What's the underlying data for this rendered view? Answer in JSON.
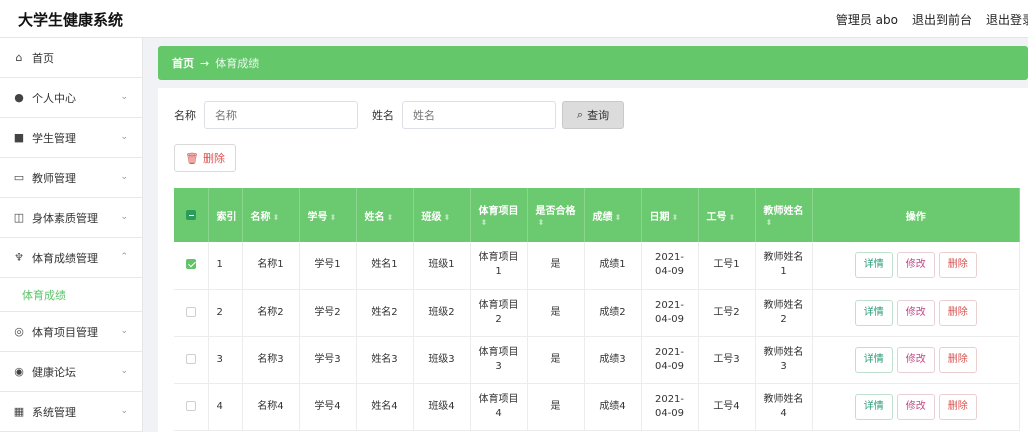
{
  "app": {
    "title": "大学生健康系统"
  },
  "topbar": {
    "user": "管理员 abo",
    "to_front": "退出到前台",
    "logout": "退出登录"
  },
  "sidebar": {
    "items": [
      {
        "label": "首页",
        "icon": "home-icon",
        "glyph": "⌂",
        "chevron": ""
      },
      {
        "label": "个人中心",
        "icon": "user-icon",
        "glyph": "●",
        "chevron": "⌄"
      },
      {
        "label": "学生管理",
        "icon": "grid-icon",
        "glyph": "■",
        "chevron": "⌄"
      },
      {
        "label": "教师管理",
        "icon": "chat-icon",
        "glyph": "▭",
        "chevron": "⌄"
      },
      {
        "label": "身体素质管理",
        "icon": "chart-icon",
        "glyph": "◫",
        "chevron": "⌄"
      },
      {
        "label": "体育成绩管理",
        "icon": "mic-icon",
        "glyph": "♆",
        "chevron": "⌃"
      }
    ],
    "submenu": {
      "label": "体育成绩"
    },
    "items2": [
      {
        "label": "体育项目管理",
        "icon": "target-icon",
        "glyph": "◎",
        "chevron": "⌄"
      },
      {
        "label": "健康论坛",
        "icon": "forum-icon",
        "glyph": "◉",
        "chevron": "⌄"
      },
      {
        "label": "系统管理",
        "icon": "apps-icon",
        "glyph": "▦",
        "chevron": "⌄"
      }
    ]
  },
  "breadcrumb": {
    "home": "首页",
    "arrow": "→",
    "current": "体育成绩"
  },
  "search": {
    "name_label": "名称",
    "name_placeholder": "名称",
    "xm_label": "姓名",
    "xm_placeholder": "姓名",
    "query_label": "查询",
    "query_icon": "search-icon"
  },
  "toolbar": {
    "delete_label": "删除",
    "delete_icon": "trash-icon"
  },
  "table": {
    "headers": [
      "索引",
      "名称",
      "学号",
      "姓名",
      "班级",
      "体育项目",
      "是否合格",
      "成绩",
      "日期",
      "工号",
      "教师姓名",
      "操作"
    ],
    "rows": [
      {
        "checked": true,
        "index": "1",
        "name": "名称1",
        "sno": "学号1",
        "xm": "姓名1",
        "cls": "班级1",
        "item": "体育项目1",
        "pass": "是",
        "score": "成绩1",
        "date": "2021-04-09",
        "gh": "工号1",
        "teacher": "教师姓名1"
      },
      {
        "checked": false,
        "index": "2",
        "name": "名称2",
        "sno": "学号2",
        "xm": "姓名2",
        "cls": "班级2",
        "item": "体育项目2",
        "pass": "是",
        "score": "成绩2",
        "date": "2021-04-09",
        "gh": "工号2",
        "teacher": "教师姓名2"
      },
      {
        "checked": false,
        "index": "3",
        "name": "名称3",
        "sno": "学号3",
        "xm": "姓名3",
        "cls": "班级3",
        "item": "体育项目3",
        "pass": "是",
        "score": "成绩3",
        "date": "2021-04-09",
        "gh": "工号3",
        "teacher": "教师姓名3"
      },
      {
        "checked": false,
        "index": "4",
        "name": "名称4",
        "sno": "学号4",
        "xm": "姓名4",
        "cls": "班级4",
        "item": "体育项目4",
        "pass": "是",
        "score": "成绩4",
        "date": "2021-04-09",
        "gh": "工号4",
        "teacher": "教师姓名4"
      }
    ],
    "actions": {
      "view": "详情",
      "edit": "修改",
      "delete": "删除"
    }
  },
  "colors": {
    "accent": "#64c86b",
    "header_green": "#6bca6f",
    "danger": "#d9534f"
  }
}
